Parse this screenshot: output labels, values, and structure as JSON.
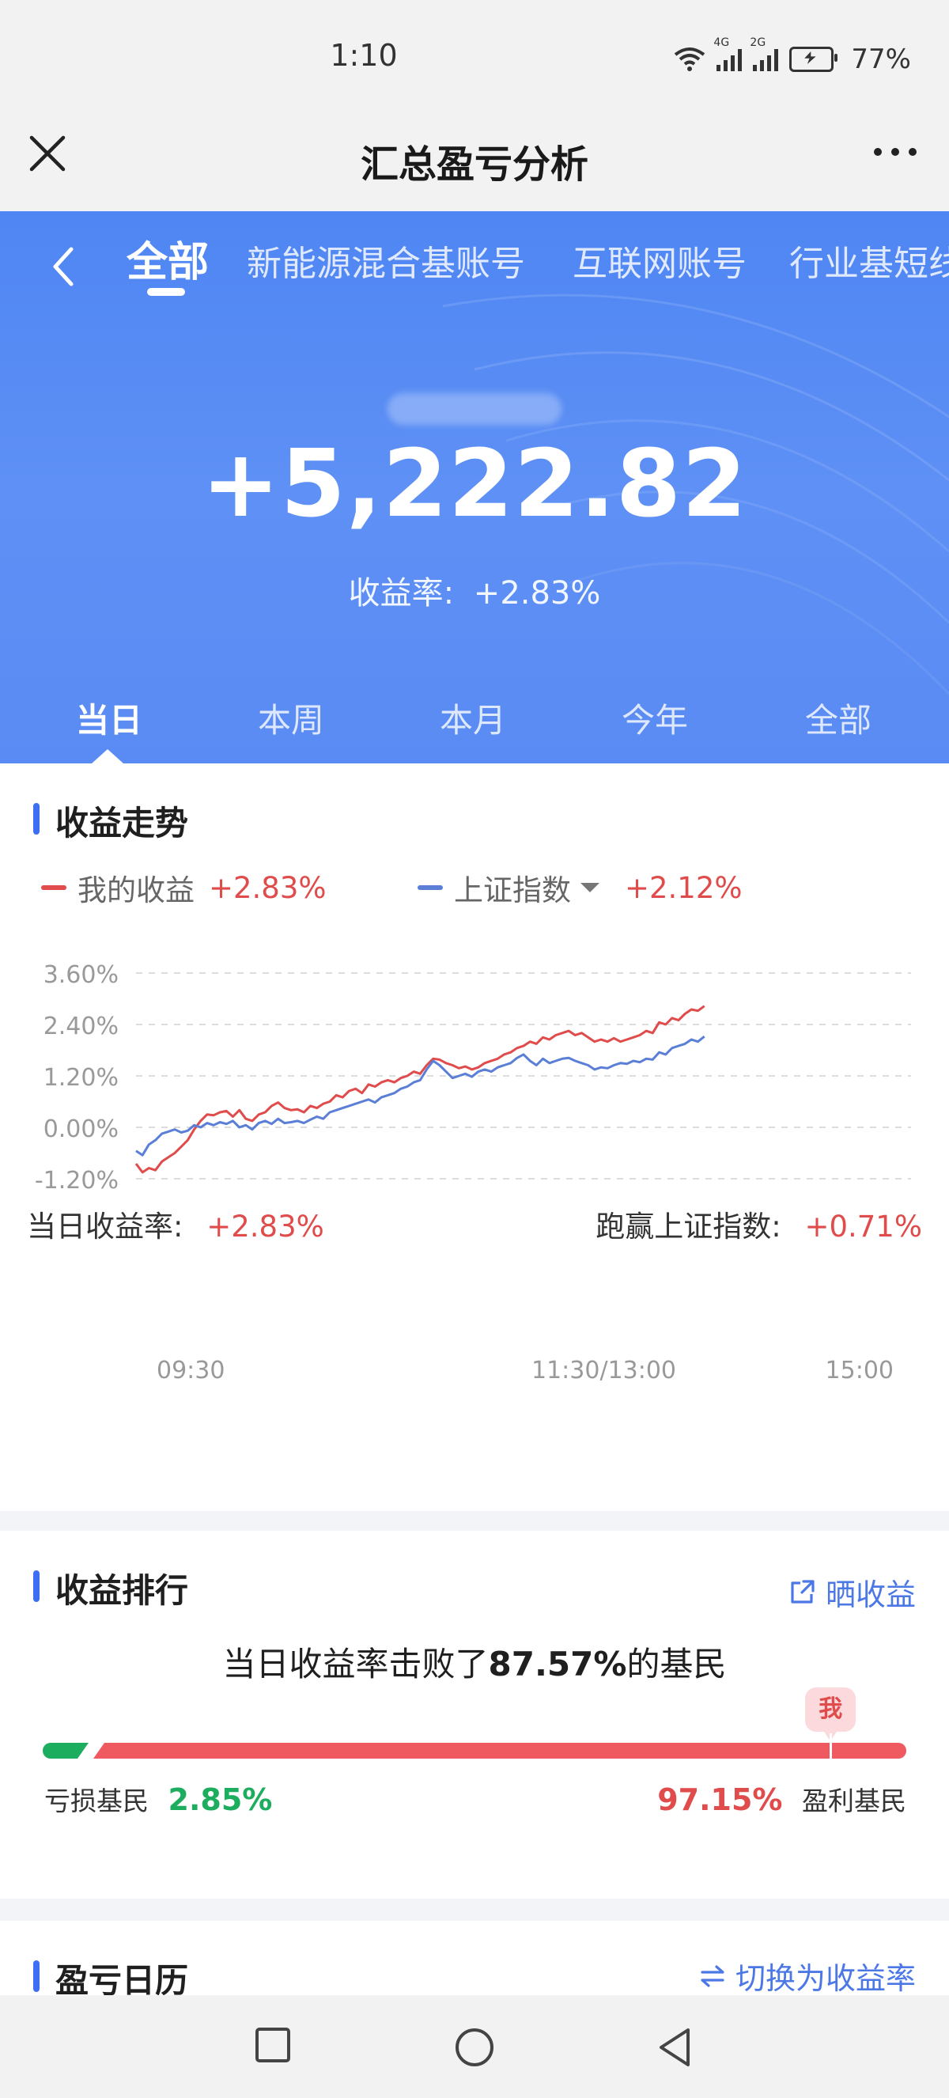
{
  "status_bar": {
    "time": "1:10",
    "net1": "4G",
    "net2": "2G",
    "battery": "77%"
  },
  "nav": {
    "title": "汇总盈亏分析"
  },
  "account_tabs": [
    {
      "label": "全部",
      "active": true
    },
    {
      "label": "新能源混合基账号"
    },
    {
      "label": "互联网账号"
    },
    {
      "label": "行业基短线"
    }
  ],
  "summary": {
    "profit": "+5,222.82",
    "rate_label": "收益率:",
    "rate_value": "+2.83%"
  },
  "period_tabs": [
    {
      "label": "当日",
      "active": true
    },
    {
      "label": "本周"
    },
    {
      "label": "本月"
    },
    {
      "label": "今年"
    },
    {
      "label": "全部"
    }
  ],
  "trend": {
    "title": "收益走势",
    "legend": [
      {
        "name": "我的收益",
        "value": "+2.83%",
        "color": "#e04b4b"
      },
      {
        "name": "上证指数",
        "value": "+2.12%",
        "color": "#5b7fd6"
      }
    ],
    "day_rate_label": "当日收益率:",
    "day_rate_value": "+2.83%",
    "beat_label": "跑赢上证指数:",
    "beat_value": "+0.71%"
  },
  "chart_data": {
    "type": "line",
    "title": "",
    "xlabel": "",
    "ylabel": "",
    "ylim": [
      -1.2,
      3.6
    ],
    "yticks": [
      "3.60%",
      "2.40%",
      "1.20%",
      "0.00%",
      "-1.20%"
    ],
    "yticks_values": [
      3.6,
      2.4,
      1.2,
      0.0,
      -1.2
    ],
    "xticks": [
      "09:30",
      "11:30/13:00",
      "15:00"
    ],
    "xticks_values": [
      0,
      120,
      240
    ],
    "xlim": [
      0,
      240
    ],
    "grid": true,
    "legend_position": "top-left",
    "series": [
      {
        "name": "我的收益",
        "color": "#e04b4b",
        "x": [
          0,
          2,
          4,
          6,
          8,
          10,
          12,
          14,
          16,
          18,
          20,
          22,
          24,
          26,
          28,
          30,
          32,
          34,
          36,
          38,
          40,
          42,
          44,
          46,
          48,
          50,
          52,
          54,
          56,
          58,
          60,
          62,
          64,
          66,
          68,
          70,
          72,
          74,
          76,
          78,
          80,
          82,
          84,
          86,
          88,
          90,
          92,
          94,
          96,
          98,
          100,
          102,
          104,
          106,
          108,
          110,
          112,
          114,
          116,
          118,
          120,
          122,
          124,
          126,
          128,
          130,
          132,
          134,
          136,
          138,
          140,
          142,
          144,
          146,
          148,
          150,
          152,
          154,
          156,
          158,
          160,
          162,
          164,
          166,
          168,
          170,
          172,
          174,
          176
        ],
        "values": [
          -0.85,
          -1.05,
          -0.95,
          -1.0,
          -0.8,
          -0.7,
          -0.6,
          -0.45,
          -0.3,
          -0.05,
          0.15,
          0.3,
          0.28,
          0.35,
          0.38,
          0.25,
          0.4,
          0.2,
          0.15,
          0.3,
          0.35,
          0.5,
          0.58,
          0.45,
          0.4,
          0.42,
          0.35,
          0.5,
          0.45,
          0.55,
          0.6,
          0.75,
          0.7,
          0.85,
          0.9,
          0.8,
          1.0,
          0.95,
          1.05,
          1.1,
          1.05,
          1.15,
          1.2,
          1.3,
          1.25,
          1.45,
          1.6,
          1.58,
          1.5,
          1.45,
          1.38,
          1.42,
          1.35,
          1.4,
          1.5,
          1.55,
          1.6,
          1.7,
          1.75,
          1.85,
          1.9,
          2.0,
          1.95,
          2.1,
          2.05,
          2.15,
          2.2,
          2.25,
          2.15,
          2.2,
          2.1,
          2.0,
          2.05,
          2.0,
          2.08,
          2.0,
          2.05,
          2.1,
          2.15,
          2.25,
          2.2,
          2.45,
          2.4,
          2.55,
          2.5,
          2.65,
          2.75,
          2.72,
          2.83
        ]
      },
      {
        "name": "上证指数",
        "color": "#5b7fd6",
        "x": [
          0,
          2,
          4,
          6,
          8,
          10,
          12,
          14,
          16,
          18,
          20,
          22,
          24,
          26,
          28,
          30,
          32,
          34,
          36,
          38,
          40,
          42,
          44,
          46,
          48,
          50,
          52,
          54,
          56,
          58,
          60,
          62,
          64,
          66,
          68,
          70,
          72,
          74,
          76,
          78,
          80,
          82,
          84,
          86,
          88,
          90,
          92,
          94,
          96,
          98,
          100,
          102,
          104,
          106,
          108,
          110,
          112,
          114,
          116,
          118,
          120,
          122,
          124,
          126,
          128,
          130,
          132,
          134,
          136,
          138,
          140,
          142,
          144,
          146,
          148,
          150,
          152,
          154,
          156,
          158,
          160,
          162,
          164,
          166,
          168,
          170,
          172,
          174,
          176
        ],
        "values": [
          -0.55,
          -0.65,
          -0.4,
          -0.3,
          -0.15,
          -0.1,
          -0.05,
          -0.12,
          -0.08,
          0.05,
          0.0,
          0.1,
          0.05,
          0.12,
          0.08,
          0.15,
          0.0,
          0.05,
          -0.05,
          0.1,
          0.15,
          0.08,
          0.2,
          0.1,
          0.12,
          0.15,
          0.1,
          0.18,
          0.25,
          0.2,
          0.35,
          0.4,
          0.45,
          0.5,
          0.55,
          0.6,
          0.65,
          0.58,
          0.7,
          0.75,
          0.8,
          0.9,
          0.95,
          1.05,
          1.1,
          1.35,
          1.55,
          1.45,
          1.3,
          1.15,
          1.2,
          1.25,
          1.18,
          1.3,
          1.35,
          1.3,
          1.4,
          1.45,
          1.5,
          1.62,
          1.7,
          1.55,
          1.45,
          1.6,
          1.5,
          1.55,
          1.6,
          1.62,
          1.55,
          1.5,
          1.45,
          1.35,
          1.4,
          1.38,
          1.45,
          1.5,
          1.48,
          1.55,
          1.52,
          1.6,
          1.58,
          1.75,
          1.7,
          1.85,
          1.9,
          1.95,
          2.05,
          2.0,
          2.12
        ]
      }
    ]
  },
  "ranking": {
    "title": "收益排行",
    "share_label": "晒收益",
    "headline_prefix": "当日收益率击败了",
    "headline_percent": "87.57%",
    "headline_suffix": "的基民",
    "me_label": "我",
    "me_position": 0.8757,
    "loss_label": "亏损基民",
    "loss_percent": "2.85%",
    "loss_fraction": 0.0285,
    "profit_label": "盈利基民",
    "profit_percent": "97.15%",
    "colors": {
      "loss": "#1cae5e",
      "profit": "#ef5a60"
    }
  },
  "calendar": {
    "title": "盈亏日历",
    "switch_label": "切换为收益率"
  }
}
